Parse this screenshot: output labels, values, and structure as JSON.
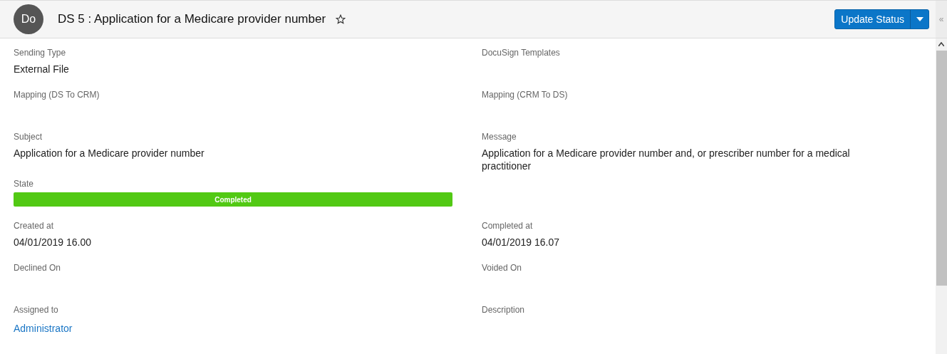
{
  "header": {
    "avatar": "Do",
    "title": "DS 5 : Application for a Medicare provider number",
    "starred": false,
    "action_button": "Update Status",
    "collapse_glyph": "«"
  },
  "fields": [
    {
      "label": "Sending Type",
      "value": "External File",
      "kind": "text"
    },
    {
      "label": "DocuSign Templates",
      "kind": "text"
    },
    {
      "label": "Mapping (DS To CRM)",
      "kind": "text"
    },
    {
      "label": "Mapping (CRM To DS)",
      "kind": "text"
    },
    {
      "label": "Subject",
      "value": "Application for a Medicare provider number",
      "kind": "text"
    },
    {
      "label": "Message",
      "value": "Application for a Medicare provider number and, or prescriber number for a medical practitioner",
      "kind": "text"
    },
    {
      "label": "State",
      "value": "Completed",
      "kind": "status"
    },
    {
      "kind": "empty"
    },
    {
      "label": "Created at",
      "value": "04/01/2019 16.00",
      "kind": "text"
    },
    {
      "label": "Completed at",
      "value": "04/01/2019 16.07",
      "kind": "text"
    },
    {
      "label": "Declined On",
      "kind": "text"
    },
    {
      "label": "Voided On",
      "kind": "text"
    },
    {
      "label": "Assigned to",
      "value": "Administrator",
      "kind": "link"
    },
    {
      "label": "Description",
      "kind": "text"
    }
  ]
}
